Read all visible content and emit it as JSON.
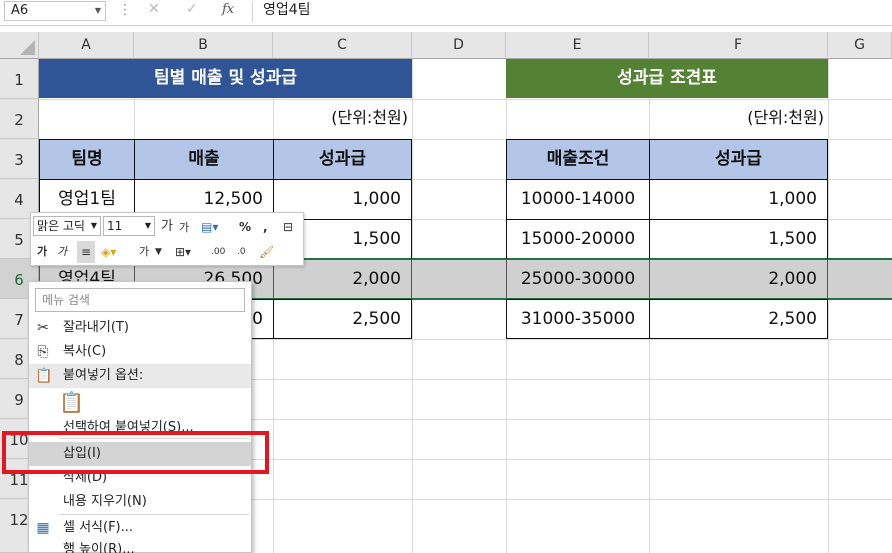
{
  "formula_bar": {
    "name_box": "A6",
    "cancel": "✕",
    "enter": "✓",
    "fx": "fx",
    "content": "영업4팀"
  },
  "columns": [
    "A",
    "B",
    "C",
    "D",
    "E",
    "F",
    "G"
  ],
  "rows": [
    "1",
    "2",
    "3",
    "4",
    "5",
    "6",
    "7",
    "8",
    "9",
    "10",
    "11",
    "12"
  ],
  "table1": {
    "title": "팀별 매출 및 성과급",
    "unit": "(단위:천원)",
    "headers": [
      "팀명",
      "매출",
      "성과급"
    ],
    "rows": [
      [
        "영업1팀",
        "12,500",
        "1,000"
      ],
      [
        "",
        "",
        "1,500"
      ],
      [
        "영업4팀",
        "26,500",
        "2,000"
      ],
      [
        "",
        "0",
        "2,500"
      ]
    ]
  },
  "table2": {
    "title": "성과급 조견표",
    "unit": "(단위:천원)",
    "headers": [
      "매출조건",
      "성과급"
    ],
    "rows": [
      [
        "10000-14000",
        "1,000"
      ],
      [
        "15000-20000",
        "1,500"
      ],
      [
        "25000-30000",
        "2,000"
      ],
      [
        "31000-35000",
        "2,500"
      ]
    ]
  },
  "mini_toolbar": {
    "font_name": "맑은 고딕",
    "font_size": "11",
    "grow_font": "가",
    "shrink_font": "가",
    "percent": "%",
    "comma": ",",
    "bold": "가",
    "italic": "가",
    "font_color": "가",
    "dec_increase": ".00",
    "dec_decrease": ".0"
  },
  "context_menu": {
    "search_placeholder": "메뉴 검색",
    "items": [
      {
        "label": "잘라내기(T)",
        "icon": "scissors-icon"
      },
      {
        "label": "복사(C)",
        "icon": "copy-icon"
      },
      {
        "label": "붙여넣기 옵션:",
        "icon": "paste-icon"
      },
      {
        "label": "선택하여 붙여넣기(S)...",
        "icon": ""
      },
      {
        "label": "삽입(I)",
        "icon": ""
      },
      {
        "label": "삭제(D)",
        "icon": ""
      },
      {
        "label": "내용 지우기(N)",
        "icon": ""
      },
      {
        "label": "셀 서식(F)...",
        "icon": "format-cells-icon"
      },
      {
        "label": "행 높이(R)...",
        "icon": ""
      }
    ]
  },
  "colors": {
    "title_blue": "#2f5597",
    "title_green": "#548235",
    "header_fill": "#b4c6e7",
    "highlight": "#e5171e"
  }
}
